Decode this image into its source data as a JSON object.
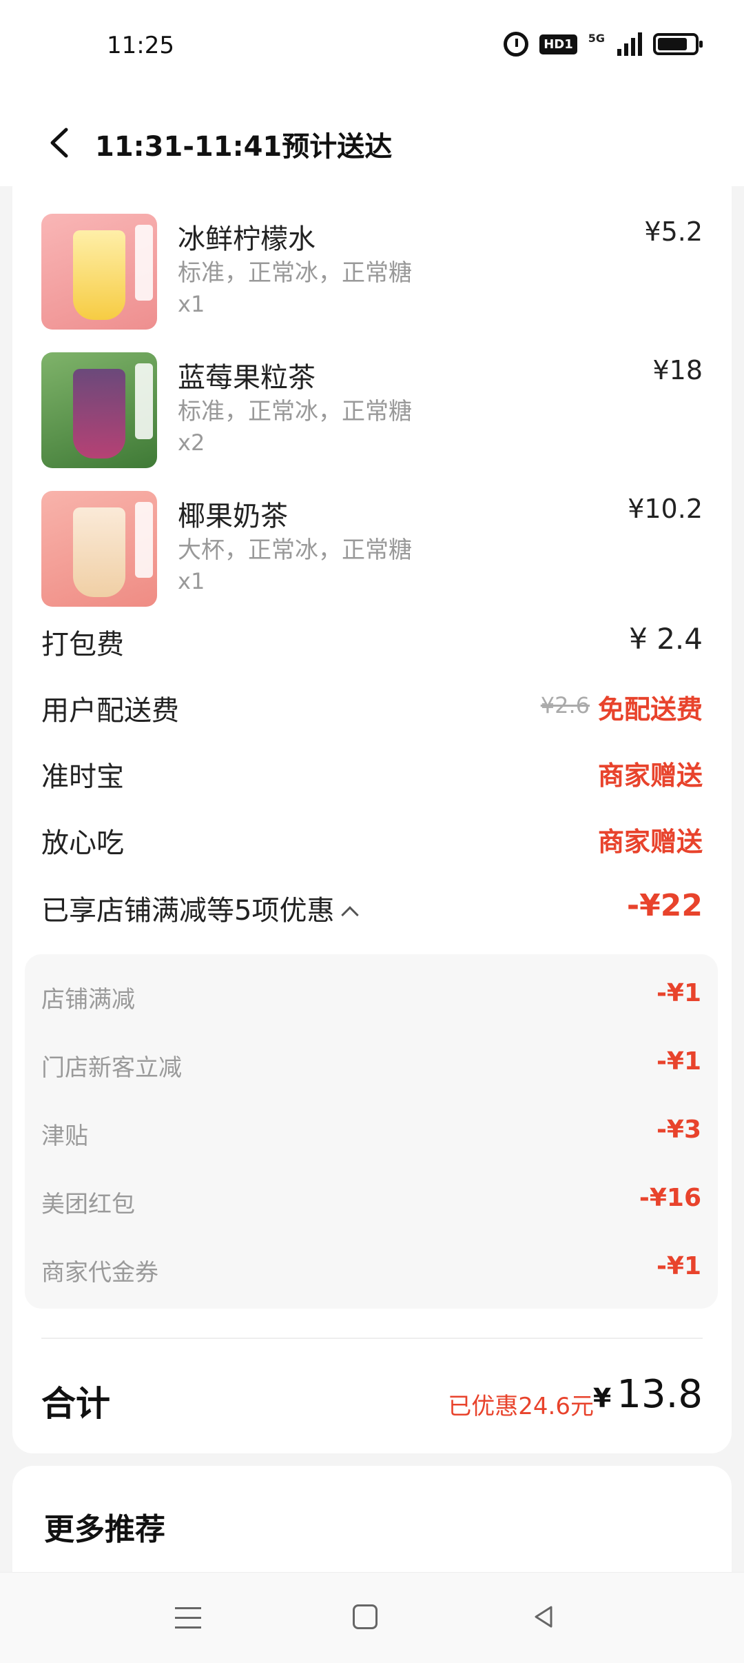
{
  "status": {
    "time": "11:25",
    "hd_badge": "HD1",
    "network": "5G"
  },
  "header": {
    "title": "11:31-11:41预计送达"
  },
  "items": [
    {
      "name": "冰鲜柠檬水",
      "spec": "标准，正常冰，正常糖",
      "qty": "x1",
      "price": "¥5.2"
    },
    {
      "name": "蓝莓果粒茶",
      "spec": "标准，正常冰，正常糖",
      "qty": "x2",
      "price": "¥18"
    },
    {
      "name": "椰果奶茶",
      "spec": "大杯，正常冰，正常糖",
      "qty": "x1",
      "price": "¥10.2"
    }
  ],
  "fees": {
    "packing_label": "打包费",
    "packing_value": "¥ 2.4",
    "delivery_label": "用户配送费",
    "delivery_original": "¥2.6",
    "delivery_value": "免配送费",
    "ontime_label": "准时宝",
    "ontime_value": "商家赠送",
    "safe_label": "放心吃",
    "safe_value": "商家赠送",
    "discount_summary_label": "已享店铺满减等5项优惠",
    "discount_summary_value": "-¥22"
  },
  "discounts": [
    {
      "label": "店铺满减",
      "value": "-¥1"
    },
    {
      "label": "门店新客立减",
      "value": "-¥1"
    },
    {
      "label": "津贴",
      "value": "-¥3"
    },
    {
      "label": "美团红包",
      "value": "-¥16"
    },
    {
      "label": "商家代金券",
      "value": "-¥1"
    }
  ],
  "total": {
    "label": "合计",
    "saved": "已优惠24.6元",
    "currency": "¥",
    "amount": "13.8"
  },
  "more": {
    "title": "更多推荐"
  },
  "colors": {
    "accent_red": "#e8432c",
    "thumb_lemon": "#f7a8a8",
    "thumb_blueberry": "#5a8f4a",
    "thumb_coconut": "#f4a7a0"
  },
  "icons": [
    "back-icon",
    "alarm-icon",
    "signal-icon",
    "battery-icon",
    "chevron-up-icon",
    "menu-icon",
    "home-icon",
    "back-nav-icon"
  ]
}
